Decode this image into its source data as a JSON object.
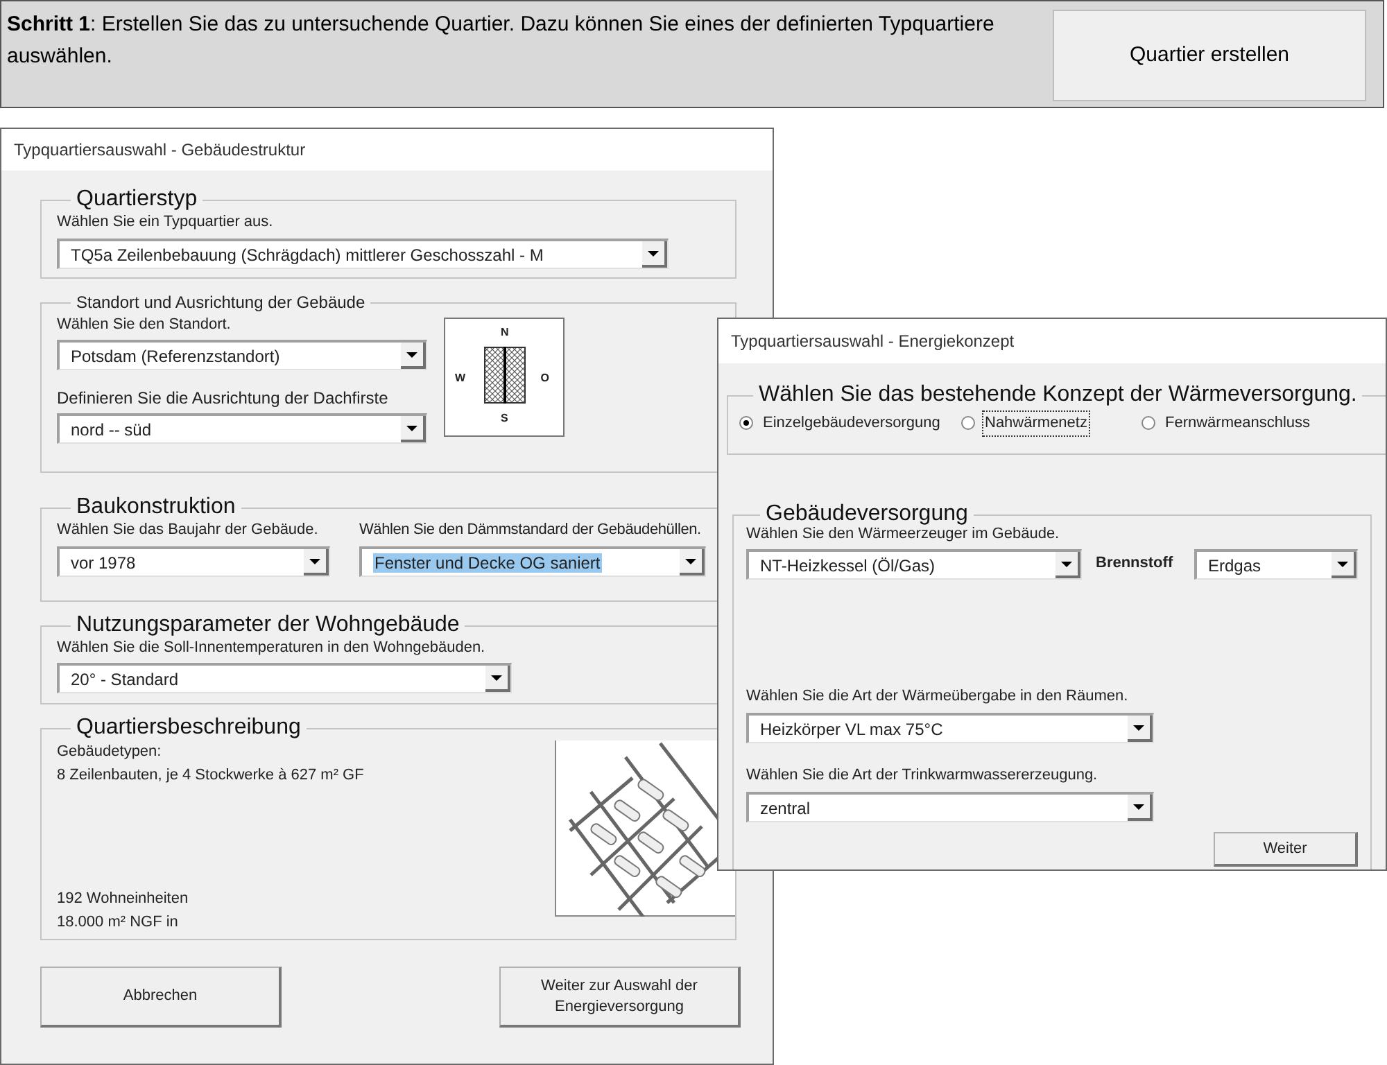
{
  "banner": {
    "text": "**Schritt 1**: Erstellen Sie das zu untersuchende Quartier. Dazu können Sie eines der definierten Typquartiere auswählen.",
    "button": "Quartier erstellen"
  },
  "structure_window": {
    "title": "Typquartiersauswahl - Gebäudestruktur",
    "quartierstyp": {
      "title": "Quartierstyp",
      "label": "Wählen Sie ein Typquartier aus.",
      "dropdown": {
        "value": "TQ5a Zeilenbebauung (Schrägdach) mittlerer Geschosszahl - M",
        "highlighted": false
      }
    },
    "standort": {
      "title": "Standort und Ausrichtung der Gebäude",
      "location_label": "Wählen Sie den Standort.",
      "location": {
        "value": "Potsdam (Referenzstandort)",
        "highlighted": false
      },
      "orientation_label": "Definieren Sie die Ausrichtung der Dachfirste",
      "orientation": {
        "value": "nord -- süd",
        "highlighted": false
      },
      "compass": {
        "north": "N",
        "west": "W",
        "east": "O",
        "south": "S"
      }
    },
    "baukonstruktion": {
      "title": "Baukonstruktion",
      "year_label": "Wählen Sie das Baujahr der Gebäude.",
      "year": {
        "value": "vor 1978",
        "highlighted": false
      },
      "insulation_label": "Wählen Sie den Dämmstandard der Gebäudehüllen.",
      "insulation": {
        "value": "Fenster und Decke OG saniert",
        "highlighted": true
      }
    },
    "nutzung": {
      "title": "Nutzungsparameter der Wohngebäude",
      "label": "Wählen Sie die Soll-Innentemperaturen in den Wohngebäuden.",
      "dropdown": {
        "value": "20° - Standard",
        "highlighted": false
      }
    },
    "beschreibung": {
      "title": "Quartiersbeschreibung",
      "lines_top": [
        "Gebäudetypen:",
        "8 Zeilenbauten, je 4 Stockwerke à 627 m² GF"
      ],
      "lines_bottom": [
        "192 Wohneinheiten",
        "18.000 m² NGF in"
      ]
    },
    "buttons": [
      "Abbrechen",
      "Weiter zur Auswahl der Energieversorgung"
    ]
  },
  "energy_window": {
    "title": "Typquartiersauswahl - Energiekonzept",
    "konzept": {
      "title": "Wählen Sie das bestehende Konzept der Wärmeversorgung.",
      "options": [
        {
          "label": "Einzelgebäudeversorgung",
          "selected": true,
          "focused": false
        },
        {
          "label": "Nahwärmenetz",
          "selected": false,
          "focused": true
        },
        {
          "label": "Fernwärmeanschluss",
          "selected": false,
          "focused": false
        }
      ]
    },
    "versorgung": {
      "title": "Gebäudeversorgung",
      "generator_label": "Wählen Sie den Wärmeerzeuger im Gebäude.",
      "generator": {
        "value": "NT-Heizkessel (Öl/Gas)",
        "highlighted": false
      },
      "fuel_label": "Brennstoff",
      "fuel": {
        "value": "Erdgas",
        "highlighted": false
      },
      "transfer_label": "Wählen Sie die Art der Wärmeübergabe in den Räumen.",
      "transfer": {
        "value": "Heizkörper VL max 75°C",
        "highlighted": false
      },
      "water_label": "Wählen Sie die Art der Trinkwarmwassererzeugung.",
      "water": {
        "value": "zentral",
        "highlighted": false
      },
      "button": "Weiter"
    }
  }
}
